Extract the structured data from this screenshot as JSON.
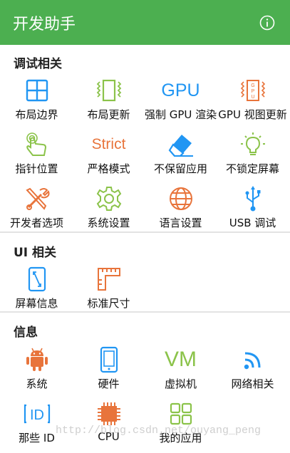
{
  "app": {
    "title": "开发助手",
    "info_icon": "info-icon"
  },
  "colors": {
    "appbar": "#4caf50",
    "blue": "#2196f3",
    "green": "#8bc34a",
    "orange": "#e8743b"
  },
  "sections": [
    {
      "title": "调试相关",
      "items": [
        {
          "label": "布局边界",
          "icon": "layout-bounds-icon"
        },
        {
          "label": "布局更新",
          "icon": "layout-update-icon"
        },
        {
          "label": "强制 GPU 渲染",
          "icon": "gpu-text-icon",
          "icon_text": "GPU"
        },
        {
          "label": "GPU 视图更新",
          "icon": "gpu-view-update-icon"
        },
        {
          "label": "指针位置",
          "icon": "pointer-hand-icon"
        },
        {
          "label": "严格模式",
          "icon": "strict-text-icon",
          "icon_text": "Strict"
        },
        {
          "label": "不保留应用",
          "icon": "eraser-icon"
        },
        {
          "label": "不锁定屏幕",
          "icon": "lightbulb-icon"
        },
        {
          "label": "开发者选项",
          "icon": "tools-icon"
        },
        {
          "label": "系统设置",
          "icon": "gear-icon"
        },
        {
          "label": "语言设置",
          "icon": "globe-icon"
        },
        {
          "label": "USB 调试",
          "icon": "usb-icon"
        }
      ]
    },
    {
      "title": "UI 相关",
      "items": [
        {
          "label": "屏幕信息",
          "icon": "screen-info-icon"
        },
        {
          "label": "标准尺寸",
          "icon": "ruler-icon"
        }
      ]
    },
    {
      "title": "信息",
      "items": [
        {
          "label": "系统",
          "icon": "android-icon"
        },
        {
          "label": "硬件",
          "icon": "phone-icon"
        },
        {
          "label": "虚拟机",
          "icon": "vm-text-icon",
          "icon_text": "VM"
        },
        {
          "label": "网络相关",
          "icon": "wifi-icon"
        },
        {
          "label": "那些 ID",
          "icon": "id-icon",
          "icon_text": "ID"
        },
        {
          "label": "CPU",
          "icon": "cpu-chip-icon"
        },
        {
          "label": "我的应用",
          "icon": "apps-grid-icon"
        }
      ]
    }
  ],
  "watermark": "http://blog.csdn.net/ouyang_peng"
}
